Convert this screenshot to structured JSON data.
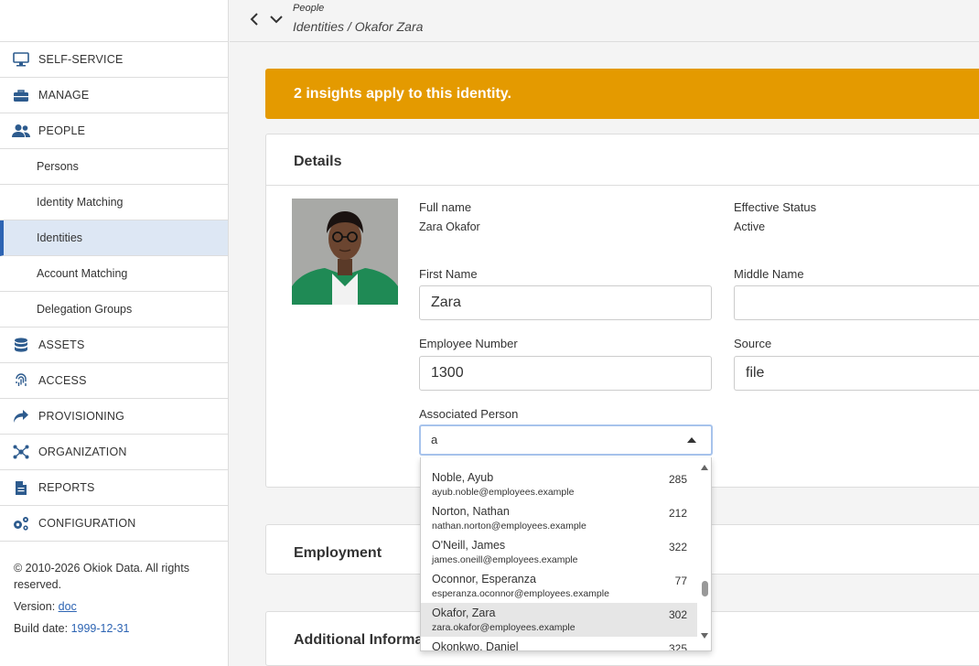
{
  "header": {
    "breadcrumb_parent": "People",
    "breadcrumb_main": "Identities / Okafor Zara"
  },
  "sidebar": {
    "items": [
      {
        "label": "SELF-SERVICE",
        "icon": "monitor-icon"
      },
      {
        "label": "MANAGE",
        "icon": "toolbox-icon"
      },
      {
        "label": "PEOPLE",
        "icon": "users-icon"
      },
      {
        "label": "ASSETS",
        "icon": "database-icon"
      },
      {
        "label": "ACCESS",
        "icon": "fingerprint-icon"
      },
      {
        "label": "PROVISIONING",
        "icon": "share-arrow-icon"
      },
      {
        "label": "ORGANIZATION",
        "icon": "network-icon"
      },
      {
        "label": "REPORTS",
        "icon": "file-icon"
      },
      {
        "label": "CONFIGURATION",
        "icon": "cogs-icon"
      }
    ],
    "people_sub": [
      "Persons",
      "Identity Matching",
      "Identities",
      "Account Matching",
      "Delegation Groups"
    ],
    "active_sub": "Identities"
  },
  "footer": {
    "copyright": "© 2010-2026 Okiok Data. All rights reserved.",
    "version_label": "Version:",
    "version_link": "doc",
    "build_label": "Build date:",
    "build_value": "1999-12-31"
  },
  "banner": {
    "text": "2 insights apply to this identity.",
    "color": "#e49a00"
  },
  "details": {
    "title": "Details",
    "full_name_label": "Full name",
    "full_name_value": "Zara Okafor",
    "status_label": "Effective Status",
    "status_value": "Active",
    "first_name_label": "First Name",
    "first_name_value": "Zara",
    "middle_name_label": "Middle Name",
    "middle_name_value": "",
    "employee_number_label": "Employee Number",
    "employee_number_value": "1300",
    "source_label": "Source",
    "source_value": "file",
    "associated_person_label": "Associated Person",
    "associated_person_value": "a"
  },
  "dropdown": {
    "options": [
      {
        "name": "Noble, Ayub",
        "email": "ayub.noble@employees.example",
        "num": "285"
      },
      {
        "name": "Norton, Nathan",
        "email": "nathan.norton@employees.example",
        "num": "212"
      },
      {
        "name": "O'Neill, James",
        "email": "james.oneill@employees.example",
        "num": "322"
      },
      {
        "name": "Oconnor, Esperanza",
        "email": "esperanza.oconnor@employees.example",
        "num": "77"
      },
      {
        "name": "Okafor, Zara",
        "email": "zara.okafor@employees.example",
        "num": "302"
      },
      {
        "name": "Okonkwo, Daniel",
        "email": "",
        "num": "325"
      }
    ],
    "highlighted_index": 4
  },
  "sections": {
    "employment_title": "Employment",
    "additional_title": "Additional Information"
  }
}
